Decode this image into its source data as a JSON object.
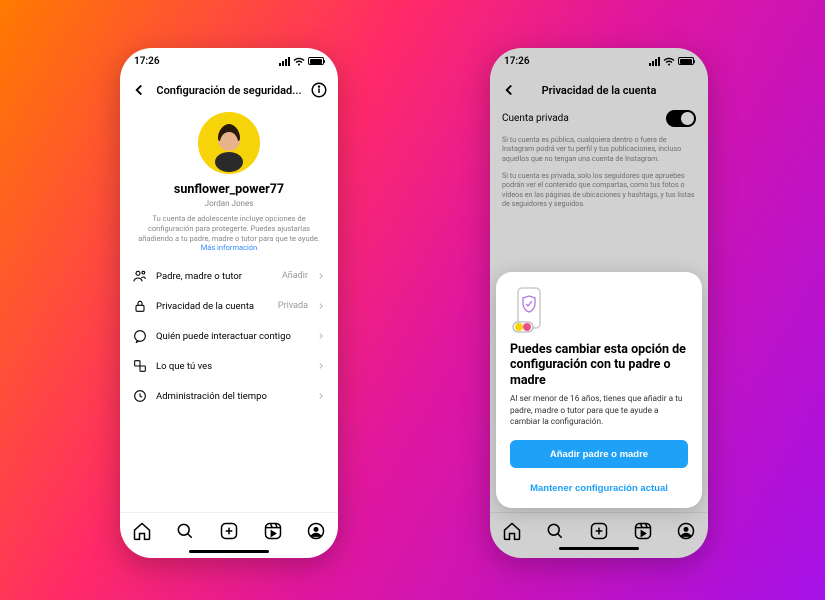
{
  "status_time": "17:26",
  "phone1": {
    "nav_title": "Configuración de seguridad...",
    "username": "sunflower_power77",
    "realname": "Jordan Jones",
    "desc_line": "Tu cuenta de adolescente incluye opciones de configuración para protegerte. Puedes ajustarlas añadiendo a tu padre, madre o tutor para que te ayude.",
    "desc_link": "Más información",
    "rows": {
      "parent": {
        "label": "Padre, madre o tutor",
        "trail": "Añadir"
      },
      "privacy": {
        "label": "Privacidad de la cuenta",
        "trail": "Privada"
      },
      "interact": {
        "label": "Quién puede interactuar contigo",
        "trail": ""
      },
      "see": {
        "label": "Lo que tú ves",
        "trail": ""
      },
      "time": {
        "label": "Administración del tiempo",
        "trail": ""
      }
    }
  },
  "phone2": {
    "nav_title": "Privacidad de la cuenta",
    "toggle_label": "Cuenta privada",
    "expl1": "Si tu cuenta es pública, cualquiera dentro o fuera de Instagram podrá ver tu perfil y tus publicaciones, incluso aquellos que no tengan una cuenta de Instagram.",
    "expl2": "Si tu cuenta es privada, solo los seguidores que apruebes podrán ver el contenido que compartas, como tus fotos o vídeos en las páginas de ubicaciones y hashtags, y tus listas de seguidores y seguidos.",
    "sheet": {
      "title": "Puedes cambiar esta opción de configuración con tu padre o madre",
      "body": "Al ser menor de 16 años, tienes que añadir a tu padre, madre o tutor para que te ayude a cambiar la configuración.",
      "primary": "Añadir padre o madre",
      "secondary": "Mantener configuración actual"
    }
  }
}
